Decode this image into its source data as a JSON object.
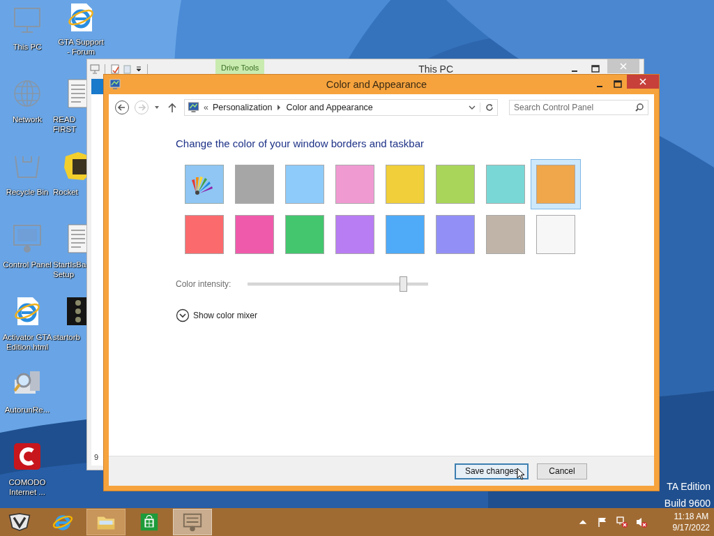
{
  "desktop_icons": [
    {
      "kind": "monitor",
      "lines": [
        "This PC"
      ]
    },
    {
      "kind": "globe",
      "lines": [
        "Network"
      ]
    },
    {
      "kind": "bin",
      "lines": [
        "Recycle Bin"
      ]
    },
    {
      "kind": "control",
      "lines": [
        "Control Panel"
      ]
    },
    {
      "kind": "ie-file",
      "lines": [
        "Activator GTA",
        "Edition.html"
      ]
    },
    {
      "kind": "autorun",
      "lines": [
        "AutorunRe..."
      ]
    },
    {
      "kind": "comodo",
      "lines": [
        "COMODO",
        "Internet ..."
      ]
    }
  ],
  "desktop_icons_column_2": [
    {
      "kind": "ie-file",
      "lines": [
        "GTA Support",
        "- Forum"
      ]
    },
    {
      "kind": "doc",
      "lines": [
        "READ",
        "FIRST"
      ]
    },
    {
      "kind": "rocket",
      "lines": [
        "Rocket"
      ]
    },
    {
      "kind": "doc",
      "lines": [
        "StartIsBa",
        "Setup"
      ]
    },
    {
      "kind": "orb",
      "lines": [
        "startorb"
      ]
    }
  ],
  "edition_text": [
    "TA Edition",
    "Build 9600"
  ],
  "explorer_window": {
    "title": "This PC",
    "context_tab": "Drive Tools",
    "status_fragment": "9"
  },
  "dialog_window": {
    "title": "Color and Appearance",
    "back": {
      "disabled": false
    },
    "forward": {
      "disabled": true
    },
    "address_bar": {
      "overflow_mark": "«",
      "crumbs": [
        "Personalization",
        "Color and Appearance"
      ]
    },
    "search": {
      "placeholder": "Search Control Panel"
    },
    "heading": "Change the color of your window borders and taskbar",
    "swatches": [
      {
        "kind": "palette",
        "selected": false
      },
      {
        "kind": "color",
        "color": "#a6a6a6",
        "selected": false
      },
      {
        "kind": "color",
        "color": "#8ecbfa",
        "selected": false
      },
      {
        "kind": "color",
        "color": "#f09ad2",
        "selected": false
      },
      {
        "kind": "color",
        "color": "#f0cf3a",
        "selected": false
      },
      {
        "kind": "color",
        "color": "#a9d55a",
        "selected": false
      },
      {
        "kind": "color",
        "color": "#79d8d6",
        "selected": false
      },
      {
        "kind": "color",
        "color": "#f0a64a",
        "selected": true
      },
      {
        "kind": "color",
        "color": "#fb6b6e",
        "selected": false
      },
      {
        "kind": "color",
        "color": "#f05aab",
        "selected": false
      },
      {
        "kind": "color",
        "color": "#44c66f",
        "selected": false
      },
      {
        "kind": "color",
        "color": "#b87df2",
        "selected": false
      },
      {
        "kind": "color",
        "color": "#4fabf8",
        "selected": false
      },
      {
        "kind": "color",
        "color": "#9290f7",
        "selected": false
      },
      {
        "kind": "color",
        "color": "#c0b4a8",
        "selected": false
      },
      {
        "kind": "color",
        "color": "#f7f7f7",
        "selected": false
      }
    ],
    "intensity": {
      "label": "Color intensity:",
      "level": 0.86
    },
    "mixer_link": "Show color mixer",
    "buttons": [
      {
        "label": "Save changes",
        "focused": true
      },
      {
        "label": "Cancel",
        "focused": false
      }
    ]
  },
  "taskbar": {
    "items": [
      {
        "kind": "game",
        "open": false,
        "active": false
      },
      {
        "kind": "ie",
        "open": false,
        "active": false
      },
      {
        "kind": "explorer",
        "open": true,
        "active": false
      },
      {
        "kind": "store",
        "open": false,
        "active": false
      },
      {
        "kind": "control",
        "open": true,
        "active": true
      }
    ],
    "time": "11:18 AM",
    "date": "9/17/2022"
  }
}
